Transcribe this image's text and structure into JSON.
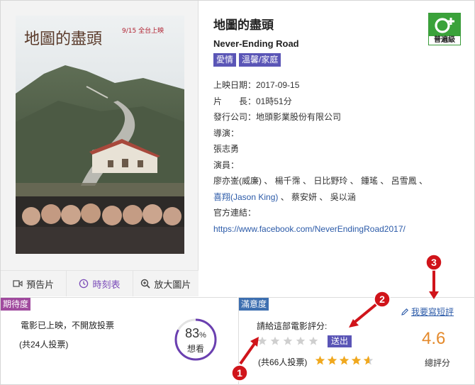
{
  "movie": {
    "title_zh": "地圖的盡頭",
    "title_en": "Never-Ending Road",
    "genres": [
      "愛情",
      "溫馨/家庭"
    ],
    "release": "上映日期：2017-09-15",
    "runtime": "片　　長：01時51分",
    "distributor": "發行公司：地頭影業股份有限公司",
    "director_label": "導演：",
    "director": "張志勇",
    "cast_label": "演員：",
    "cast_line1": "廖亦崟(威廉) 、 楊千霈 、 日比野玲 、 鍾瑤 、 呂雪鳳 、",
    "cast_line2_link": "喜翔(Jason King)",
    "cast_line2_rest": " 、 蔡安妍 、 吳以涵",
    "official_label": "官方連結：",
    "official_url": "https://www.facebook.com/NeverEndingRoad2017/",
    "rating_label": "普遍級"
  },
  "poster": {
    "title_text": "地圖的盡頭",
    "date_text": "9/15 全台上映"
  },
  "poster_buttons": {
    "trailer": "預告片",
    "showtimes": "時刻表",
    "enlarge": "放大圖片"
  },
  "expectation": {
    "tag": "期待度",
    "message": "電影已上映，不開放投票",
    "votes": "(共24人投票)",
    "percent": "83",
    "percent_sign": "%",
    "percent_value": 83,
    "label": "想看"
  },
  "satisfaction": {
    "tag": "滿意度",
    "ask": "請給這部電影評分:",
    "send": "送出",
    "votes": "(共66人投票)",
    "average_stars": 4.6,
    "write_review": "我要寫短評",
    "score": "4.6",
    "score_label": "總評分"
  },
  "annotations": [
    "1",
    "2",
    "3"
  ],
  "colors": {
    "tag_purple": "#5a55b6",
    "link_blue": "#2b5aa8",
    "score_orange": "#e48a2c",
    "annotation_red": "#d0141a",
    "rating_green": "#3aa23a"
  }
}
